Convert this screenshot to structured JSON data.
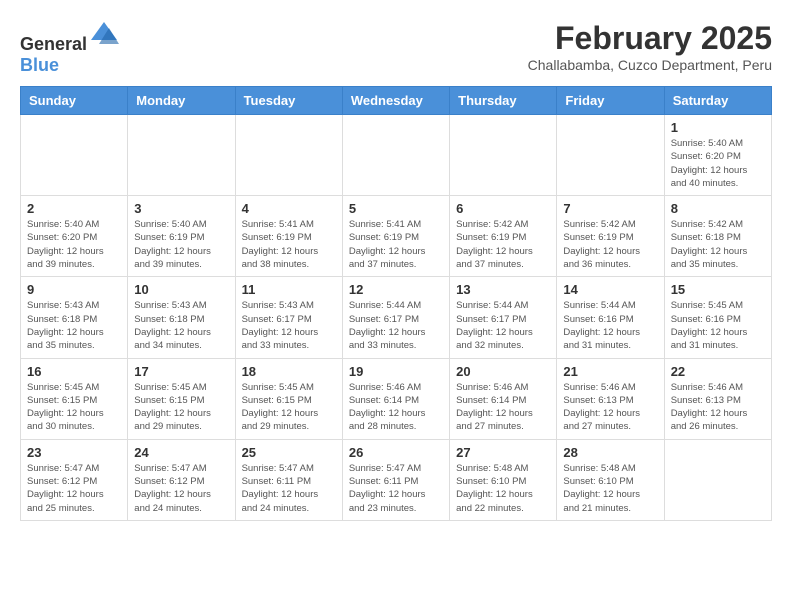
{
  "header": {
    "logo_general": "General",
    "logo_blue": "Blue",
    "title": "February 2025",
    "subtitle": "Challabamba, Cuzco Department, Peru"
  },
  "days_of_week": [
    "Sunday",
    "Monday",
    "Tuesday",
    "Wednesday",
    "Thursday",
    "Friday",
    "Saturday"
  ],
  "weeks": [
    [
      {
        "day": "",
        "info": ""
      },
      {
        "day": "",
        "info": ""
      },
      {
        "day": "",
        "info": ""
      },
      {
        "day": "",
        "info": ""
      },
      {
        "day": "",
        "info": ""
      },
      {
        "day": "",
        "info": ""
      },
      {
        "day": "1",
        "info": "Sunrise: 5:40 AM\nSunset: 6:20 PM\nDaylight: 12 hours and 40 minutes."
      }
    ],
    [
      {
        "day": "2",
        "info": "Sunrise: 5:40 AM\nSunset: 6:20 PM\nDaylight: 12 hours and 39 minutes."
      },
      {
        "day": "3",
        "info": "Sunrise: 5:40 AM\nSunset: 6:19 PM\nDaylight: 12 hours and 39 minutes."
      },
      {
        "day": "4",
        "info": "Sunrise: 5:41 AM\nSunset: 6:19 PM\nDaylight: 12 hours and 38 minutes."
      },
      {
        "day": "5",
        "info": "Sunrise: 5:41 AM\nSunset: 6:19 PM\nDaylight: 12 hours and 37 minutes."
      },
      {
        "day": "6",
        "info": "Sunrise: 5:42 AM\nSunset: 6:19 PM\nDaylight: 12 hours and 37 minutes."
      },
      {
        "day": "7",
        "info": "Sunrise: 5:42 AM\nSunset: 6:19 PM\nDaylight: 12 hours and 36 minutes."
      },
      {
        "day": "8",
        "info": "Sunrise: 5:42 AM\nSunset: 6:18 PM\nDaylight: 12 hours and 35 minutes."
      }
    ],
    [
      {
        "day": "9",
        "info": "Sunrise: 5:43 AM\nSunset: 6:18 PM\nDaylight: 12 hours and 35 minutes."
      },
      {
        "day": "10",
        "info": "Sunrise: 5:43 AM\nSunset: 6:18 PM\nDaylight: 12 hours and 34 minutes."
      },
      {
        "day": "11",
        "info": "Sunrise: 5:43 AM\nSunset: 6:17 PM\nDaylight: 12 hours and 33 minutes."
      },
      {
        "day": "12",
        "info": "Sunrise: 5:44 AM\nSunset: 6:17 PM\nDaylight: 12 hours and 33 minutes."
      },
      {
        "day": "13",
        "info": "Sunrise: 5:44 AM\nSunset: 6:17 PM\nDaylight: 12 hours and 32 minutes."
      },
      {
        "day": "14",
        "info": "Sunrise: 5:44 AM\nSunset: 6:16 PM\nDaylight: 12 hours and 31 minutes."
      },
      {
        "day": "15",
        "info": "Sunrise: 5:45 AM\nSunset: 6:16 PM\nDaylight: 12 hours and 31 minutes."
      }
    ],
    [
      {
        "day": "16",
        "info": "Sunrise: 5:45 AM\nSunset: 6:15 PM\nDaylight: 12 hours and 30 minutes."
      },
      {
        "day": "17",
        "info": "Sunrise: 5:45 AM\nSunset: 6:15 PM\nDaylight: 12 hours and 29 minutes."
      },
      {
        "day": "18",
        "info": "Sunrise: 5:45 AM\nSunset: 6:15 PM\nDaylight: 12 hours and 29 minutes."
      },
      {
        "day": "19",
        "info": "Sunrise: 5:46 AM\nSunset: 6:14 PM\nDaylight: 12 hours and 28 minutes."
      },
      {
        "day": "20",
        "info": "Sunrise: 5:46 AM\nSunset: 6:14 PM\nDaylight: 12 hours and 27 minutes."
      },
      {
        "day": "21",
        "info": "Sunrise: 5:46 AM\nSunset: 6:13 PM\nDaylight: 12 hours and 27 minutes."
      },
      {
        "day": "22",
        "info": "Sunrise: 5:46 AM\nSunset: 6:13 PM\nDaylight: 12 hours and 26 minutes."
      }
    ],
    [
      {
        "day": "23",
        "info": "Sunrise: 5:47 AM\nSunset: 6:12 PM\nDaylight: 12 hours and 25 minutes."
      },
      {
        "day": "24",
        "info": "Sunrise: 5:47 AM\nSunset: 6:12 PM\nDaylight: 12 hours and 24 minutes."
      },
      {
        "day": "25",
        "info": "Sunrise: 5:47 AM\nSunset: 6:11 PM\nDaylight: 12 hours and 24 minutes."
      },
      {
        "day": "26",
        "info": "Sunrise: 5:47 AM\nSunset: 6:11 PM\nDaylight: 12 hours and 23 minutes."
      },
      {
        "day": "27",
        "info": "Sunrise: 5:48 AM\nSunset: 6:10 PM\nDaylight: 12 hours and 22 minutes."
      },
      {
        "day": "28",
        "info": "Sunrise: 5:48 AM\nSunset: 6:10 PM\nDaylight: 12 hours and 21 minutes."
      },
      {
        "day": "",
        "info": ""
      }
    ]
  ]
}
